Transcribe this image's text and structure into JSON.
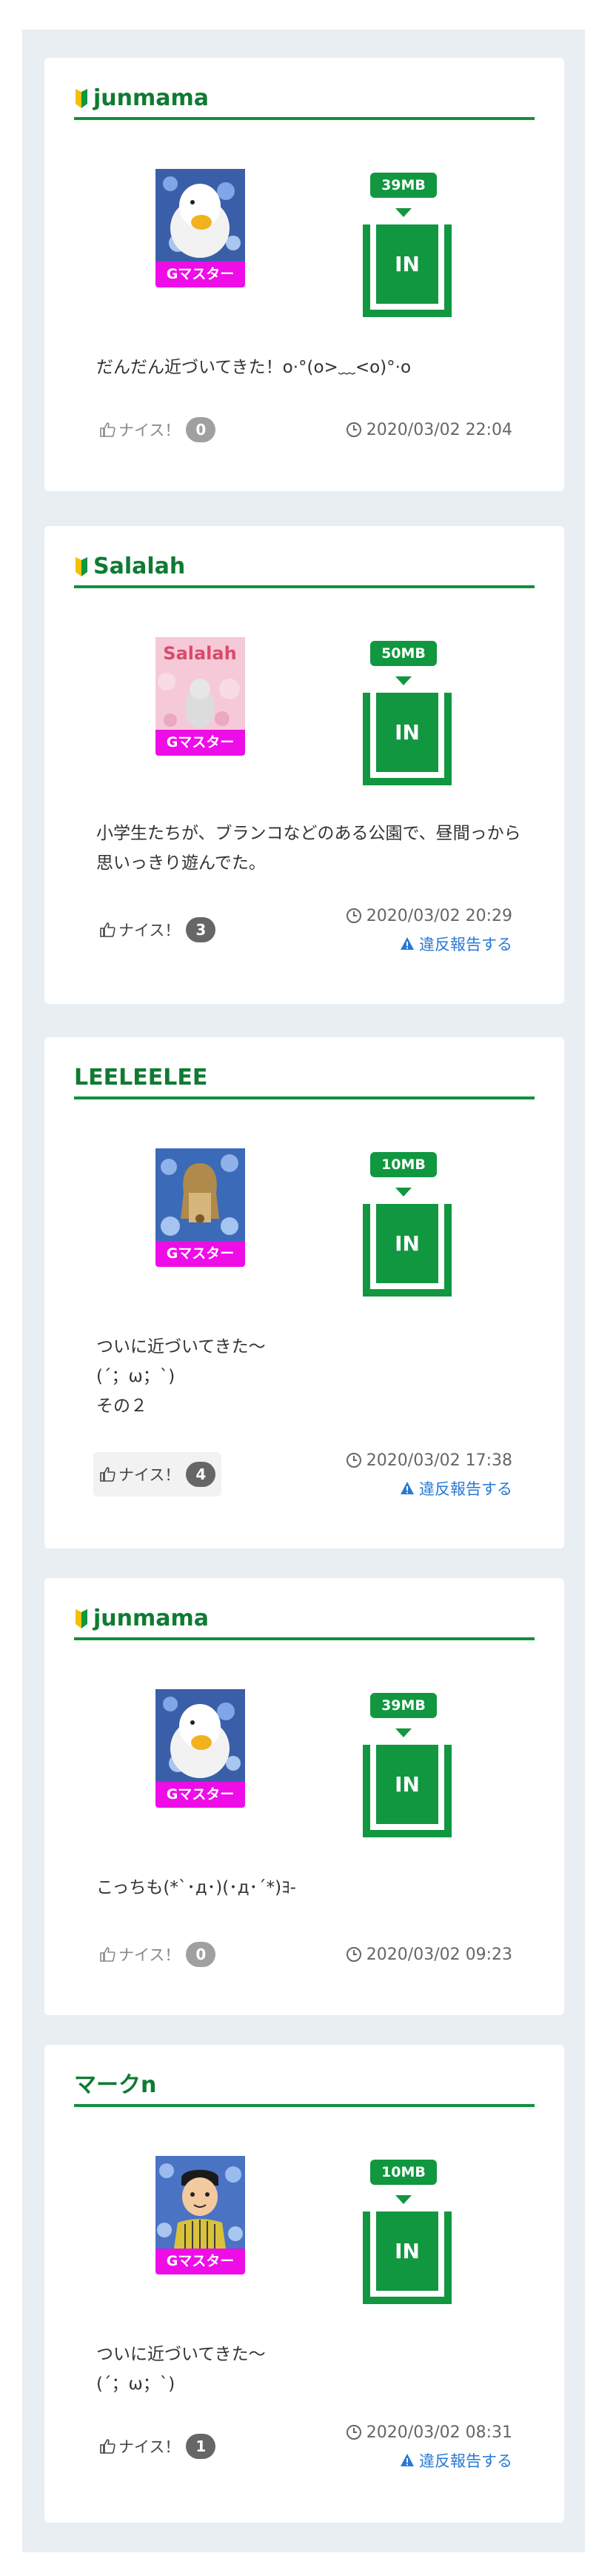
{
  "posts": [
    {
      "user": "junmama",
      "beginner_mark": true,
      "badge": "Gマスター",
      "size": "39MB",
      "in_label": "IN",
      "comment": "だんだん近づいてきた！o·°(o>﹏<o)°·o",
      "like_label": "ナイス！",
      "like_count": "0",
      "time": "2020/03/02 22:04",
      "report": ""
    },
    {
      "user": "Salalah",
      "beginner_mark": true,
      "badge": "Gマスター",
      "avatar_text": "Salalah",
      "size": "50MB",
      "in_label": "IN",
      "comment": "小学生たちが、ブランコなどのある公園で、昼間っから思いっきり遊んでた。",
      "like_label": "ナイス！",
      "like_count": "3",
      "time": "2020/03/02 20:29",
      "report": "違反報告する"
    },
    {
      "user": "LEELEELEE",
      "beginner_mark": false,
      "badge": "Gマスター",
      "size": "10MB",
      "in_label": "IN",
      "comment": "ついに近づいてきた〜\n(´；ω；`)\nその２",
      "like_label": "ナイス！",
      "like_count": "4",
      "time": "2020/03/02 17:38",
      "report": "違反報告する"
    },
    {
      "user": "junmama",
      "beginner_mark": true,
      "badge": "Gマスター",
      "size": "39MB",
      "in_label": "IN",
      "comment": "こっちも(*`･д･)(･д･´*)ﾖ-",
      "like_label": "ナイス！",
      "like_count": "0",
      "time": "2020/03/02 09:23",
      "report": ""
    },
    {
      "user": "マークn",
      "beginner_mark": false,
      "badge": "Gマスター",
      "size": "10MB",
      "in_label": "IN",
      "comment": "ついに近づいてきた〜\n(´；ω；`)",
      "like_label": "ナイス！",
      "like_count": "1",
      "time": "2020/03/02 08:31",
      "report": "違反報告する"
    }
  ],
  "colors": {
    "brand_green": "#11973f",
    "name_green": "#0f7b32",
    "badge_magenta": "#ee0ce7",
    "report_blue": "#2779d5",
    "panel_bg": "#e9eef3"
  },
  "icons": {
    "beginner": "beginner-mark-icon",
    "like": "thumbs-up-icon",
    "clock": "clock-icon",
    "report": "warning-icon"
  }
}
